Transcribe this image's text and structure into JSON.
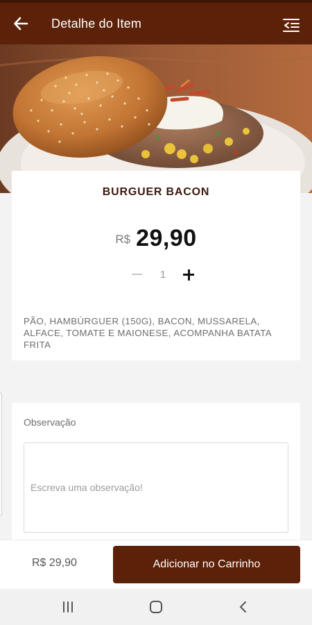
{
  "header": {
    "title": "Detalhe do Item",
    "back_icon": "arrow-left-icon",
    "menu_icon": "menu-list-icon",
    "color": "#5c2109"
  },
  "product": {
    "name": "BURGUER BACON",
    "currency": "R$",
    "price": "29,90",
    "quantity": "1",
    "description": "PÃO, HAMBÚRGUER (150G), BACON, MUSSARELA, ALFACE, TOMATE E MAIONESE, ACOMPANHA BATATA FRITA"
  },
  "observation": {
    "label": "Observação",
    "placeholder": "Escreva uma observação!",
    "value": ""
  },
  "footer": {
    "total": "R$ 29,90",
    "add_button": "Adicionar no Carrinho",
    "button_color": "#5c2109"
  },
  "system_nav": {
    "icons": [
      "recent-apps-icon",
      "home-icon",
      "back-icon"
    ]
  }
}
